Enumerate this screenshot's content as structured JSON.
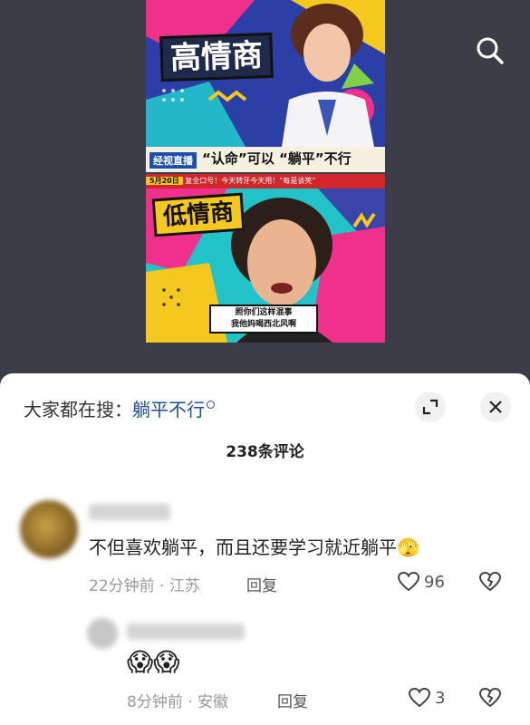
{
  "poster": {
    "title_high": "高情商",
    "title_low": "低情商",
    "program_tag": "经视直播",
    "slogan": "“认命”可以 “躺平”不行",
    "date": "5月20日",
    "ticker": "复全口号！今天转牙今天用！“每是谈笑”",
    "subtitle_line1": "照你们这样混事",
    "subtitle_line2": "我他妈喝西北风啊"
  },
  "search": {
    "icon": "search-icon"
  },
  "sheet": {
    "hot_label": "大家都在搜：",
    "hot_keyword": "躺平不行",
    "comment_count": "238条评论"
  },
  "comments": [
    {
      "text": "不但喜欢躺平，而且还要学习就近躺平🫣",
      "time": "22分钟前",
      "location": "江苏",
      "reply_label": "回复",
      "likes": "96"
    },
    {
      "text": "😱😱",
      "time": "8分钟前",
      "location": "安徽",
      "reply_label": "回复",
      "likes": "3"
    }
  ],
  "colors": {
    "accent": "#1e4e9c",
    "background": "#3a3b47"
  }
}
